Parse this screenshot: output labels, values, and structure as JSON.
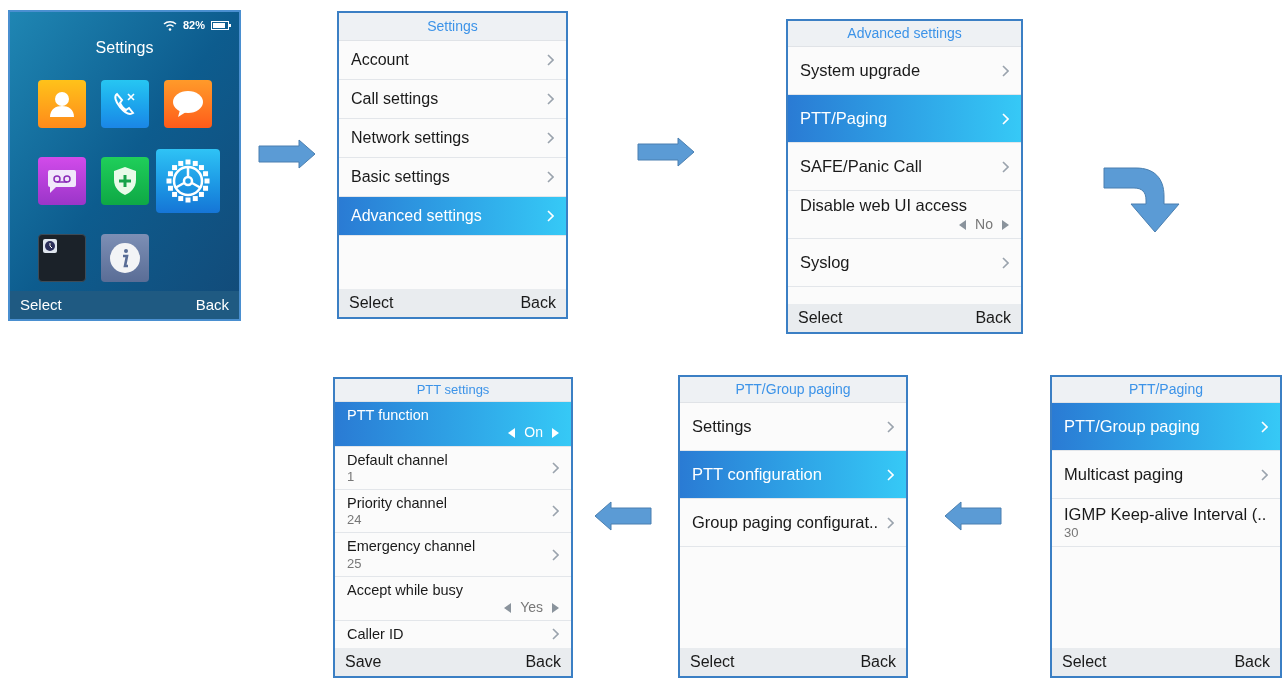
{
  "home": {
    "battery_text": "82%",
    "title": "Settings",
    "apps": [
      {
        "kind": "contacts",
        "selected": false
      },
      {
        "kind": "calls",
        "selected": false
      },
      {
        "kind": "messages",
        "selected": false
      },
      {
        "kind": "voicemail",
        "selected": false
      },
      {
        "kind": "security",
        "selected": false
      },
      {
        "kind": "settings",
        "selected": true
      },
      {
        "kind": "clock",
        "selected": false
      },
      {
        "kind": "info",
        "selected": false
      }
    ],
    "softkeys": [
      "Select",
      "Back"
    ]
  },
  "screens": [
    {
      "title": "Settings",
      "rows": [
        {
          "kind": "nav",
          "label": "Account",
          "selected": false
        },
        {
          "kind": "nav",
          "label": "Call settings",
          "selected": false
        },
        {
          "kind": "nav",
          "label": "Network settings",
          "selected": false
        },
        {
          "kind": "nav",
          "label": "Basic settings",
          "selected": false
        },
        {
          "kind": "nav",
          "label": "Advanced settings",
          "selected": true
        }
      ],
      "softkeys": [
        "Select",
        "Back"
      ]
    },
    {
      "title": "Advanced settings",
      "rows": [
        {
          "kind": "nav",
          "label": "System upgrade",
          "selected": false
        },
        {
          "kind": "nav",
          "label": "PTT/Paging",
          "selected": true
        },
        {
          "kind": "nav",
          "label": "SAFE/Panic Call",
          "selected": false
        },
        {
          "kind": "toggle",
          "label": "Disable web UI access",
          "value": "No",
          "selected": false
        },
        {
          "kind": "nav",
          "label": "Syslog",
          "selected": false
        }
      ],
      "softkeys": [
        "Select",
        "Back"
      ]
    },
    {
      "title": "PTT settings",
      "rows": [
        {
          "kind": "toggle",
          "label": "PTT function",
          "value": "On",
          "selected": true
        },
        {
          "kind": "value_nav",
          "label": "Default channel",
          "value": "1",
          "selected": false
        },
        {
          "kind": "value_nav",
          "label": "Priority channel",
          "value": "24",
          "selected": false
        },
        {
          "kind": "value_nav",
          "label": "Emergency channel",
          "value": "25",
          "selected": false
        },
        {
          "kind": "toggle",
          "label": "Accept while busy",
          "value": "Yes",
          "selected": false
        },
        {
          "kind": "nav",
          "label": "Caller ID",
          "selected": false
        }
      ],
      "softkeys": [
        "Save",
        "Back"
      ]
    },
    {
      "title": "PTT/Group paging",
      "rows": [
        {
          "kind": "nav",
          "label": "Settings",
          "selected": false
        },
        {
          "kind": "nav",
          "label": "PTT configuration",
          "selected": true
        },
        {
          "kind": "nav",
          "label": "Group paging configurat..",
          "selected": false
        }
      ],
      "softkeys": [
        "Select",
        "Back"
      ]
    },
    {
      "title": "PTT/Paging",
      "rows": [
        {
          "kind": "nav",
          "label": "PTT/Group paging",
          "selected": true
        },
        {
          "kind": "nav",
          "label": "Multicast paging",
          "selected": false
        },
        {
          "kind": "info",
          "label": "IGMP Keep-alive Interval (..",
          "value": "30",
          "selected": false
        }
      ],
      "softkeys": [
        "Select",
        "Back"
      ]
    }
  ]
}
